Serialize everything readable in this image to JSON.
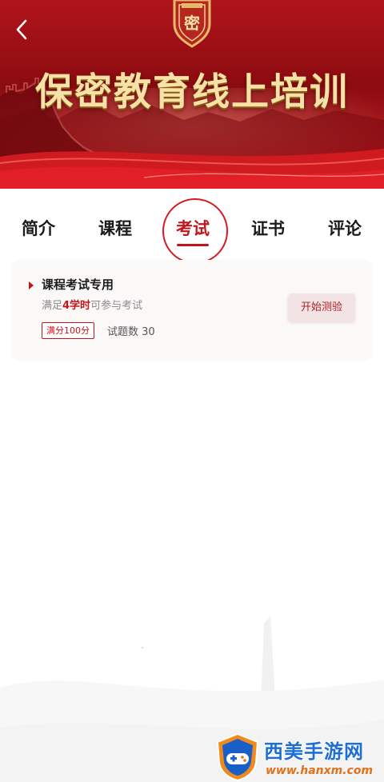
{
  "banner": {
    "title": "保密教育线上培训",
    "emblem_text": "密"
  },
  "tabs": [
    {
      "label": "简介",
      "active": false
    },
    {
      "label": "课程",
      "active": false
    },
    {
      "label": "考试",
      "active": true
    },
    {
      "label": "证书",
      "active": false
    },
    {
      "label": "评论",
      "active": false
    }
  ],
  "exam": {
    "title": "课程考试专用",
    "desc_prefix": "满足",
    "desc_highlight": "4学时",
    "desc_suffix": "可参与考试",
    "score_badge": "满分100分",
    "question_count": "试题数 30",
    "start_button": "开始测验"
  },
  "watermark": {
    "brand": "西美手游网",
    "url": "www.hanxm.com"
  },
  "colors": {
    "accent": "#c4141b",
    "banner_red": "#b0141a",
    "title_gold": "#f6e2a6",
    "watermark_blue": "#1d6fd6",
    "watermark_orange": "#e0721b"
  },
  "icons": {
    "back": "chevron-left-icon",
    "emblem": "secrecy-emblem-icon",
    "card_marker": "triangle-marker-icon",
    "watermark_logo": "gamepad-shield-icon"
  }
}
